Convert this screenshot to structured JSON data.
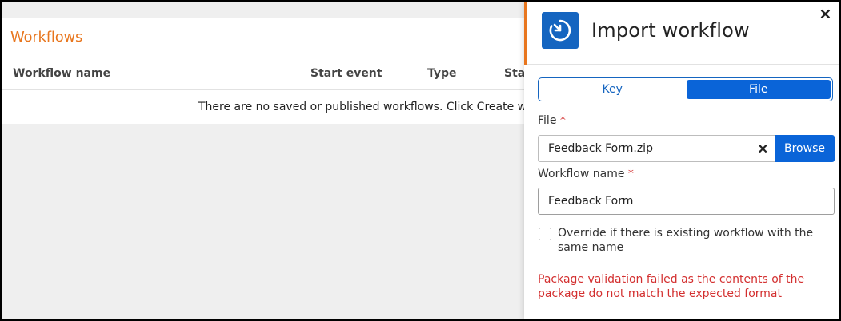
{
  "workflows": {
    "title": "Workflows",
    "columns": [
      "Workflow name",
      "Start event",
      "Type",
      "Stat"
    ],
    "empty_message": "There are no saved or published workflows. Click Create workfl"
  },
  "panel": {
    "title": "Import workflow",
    "icon": "import-clock-icon",
    "close_icon": "close-icon",
    "tabs": [
      {
        "label": "Key",
        "active": false
      },
      {
        "label": "File",
        "active": true
      }
    ],
    "file_label": "File",
    "required_mark": "*",
    "file_value": "Feedback Form.zip",
    "clear_icon": "✕",
    "browse_label": "Browse",
    "name_label": "Workflow name",
    "name_value": "Feedback Form",
    "override_label": "Override if there is existing workflow with the same name",
    "override_checked": false,
    "error": "Package validation failed as the contents of the package do not match the expected format"
  },
  "colors": {
    "accent": "#e8761e",
    "primary": "#0a64d8",
    "error": "#d32f2f"
  }
}
